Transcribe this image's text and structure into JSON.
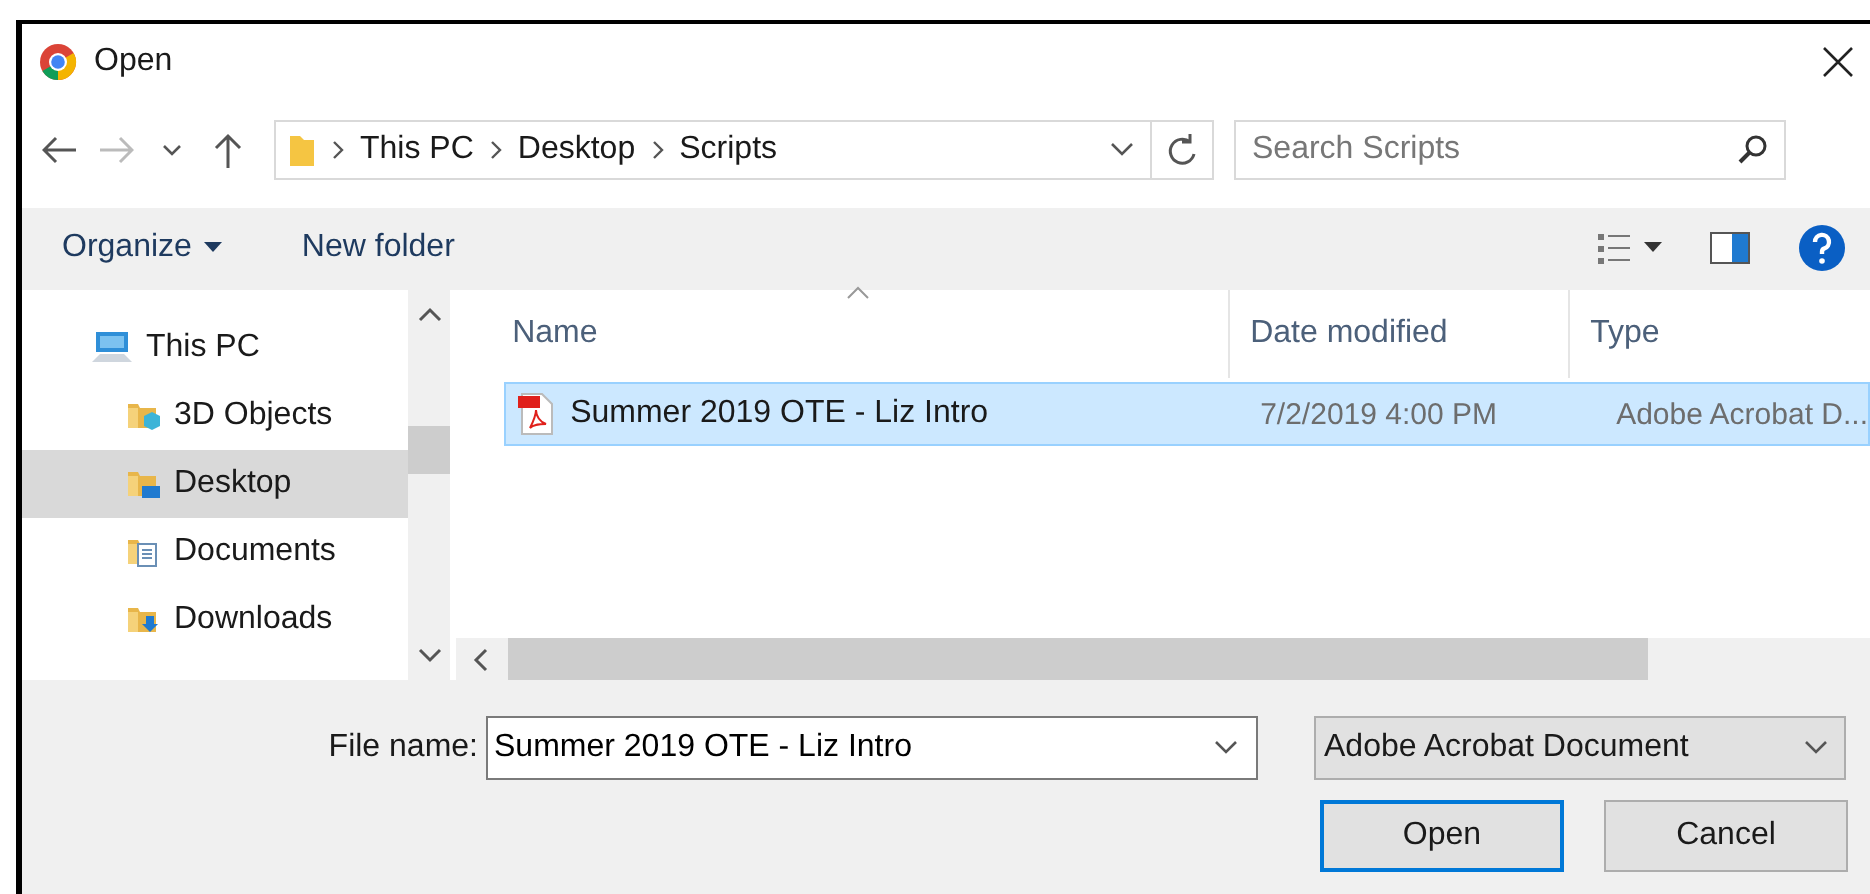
{
  "window": {
    "title": "Open"
  },
  "nav": {
    "path": [
      "This PC",
      "Desktop",
      "Scripts"
    ],
    "search": {
      "placeholder": "Search Scripts"
    }
  },
  "toolbar": {
    "organize": "Organize",
    "new_folder": "New folder"
  },
  "sidebar": {
    "items": [
      {
        "label": "This PC",
        "kind": "pc",
        "selected": false,
        "children": [
          {
            "label": "3D Objects",
            "kind": "objects3d",
            "selected": false
          },
          {
            "label": "Desktop",
            "kind": "desktop",
            "selected": true
          },
          {
            "label": "Documents",
            "kind": "documents",
            "selected": false
          },
          {
            "label": "Downloads",
            "kind": "downloads",
            "selected": false
          }
        ]
      }
    ]
  },
  "table": {
    "columns": [
      "Name",
      "Date modified",
      "Type"
    ],
    "rows": [
      {
        "name": "Summer 2019 OTE - Liz Intro",
        "date": "7/2/2019 4:00 PM",
        "type": "Adobe Acrobat D...",
        "selected": true
      }
    ]
  },
  "file_name": {
    "label": "File name:",
    "value": "Summer 2019 OTE - Liz Intro"
  },
  "file_type": {
    "value": "Adobe Acrobat Document"
  },
  "buttons": [
    "Open",
    "Cancel"
  ]
}
